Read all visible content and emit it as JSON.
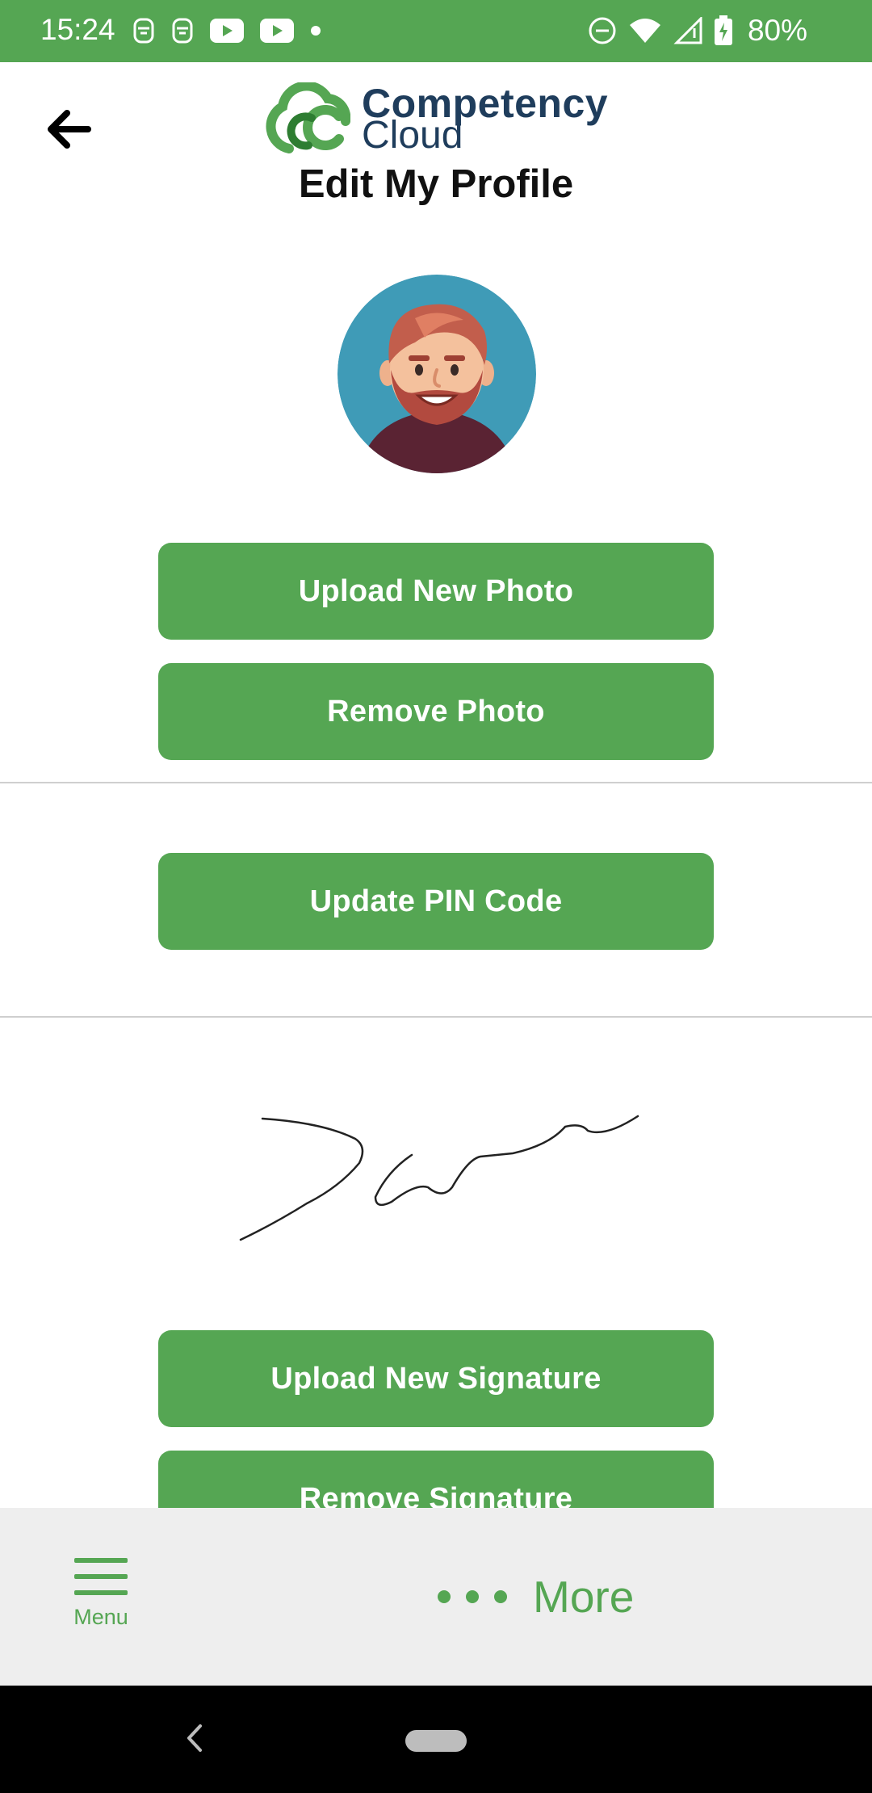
{
  "status_bar": {
    "time": "15:24",
    "battery": "80%",
    "icons_left": [
      "notification-icon",
      "notification-icon",
      "youtube-icon",
      "youtube-icon",
      "dot-icon"
    ],
    "icons_right": [
      "dnd-icon",
      "wifi-icon",
      "signal-icon",
      "battery-charging-icon"
    ],
    "color": "#55a653"
  },
  "header": {
    "back_icon": "arrow-left-icon",
    "logo_line1": "Competency",
    "logo_line2": "Cloud",
    "title": "Edit My Profile"
  },
  "profile": {
    "avatar_icon": "avatar-cartoon-man"
  },
  "buttons": {
    "upload_photo": "Upload New Photo",
    "remove_photo": "Remove Photo",
    "update_pin": "Update PIN Code",
    "upload_signature": "Upload New Signature",
    "remove_signature": "Remove Signature"
  },
  "bottom_nav": {
    "menu_label": "Menu",
    "more_label": "More",
    "accent": "#55a653"
  }
}
